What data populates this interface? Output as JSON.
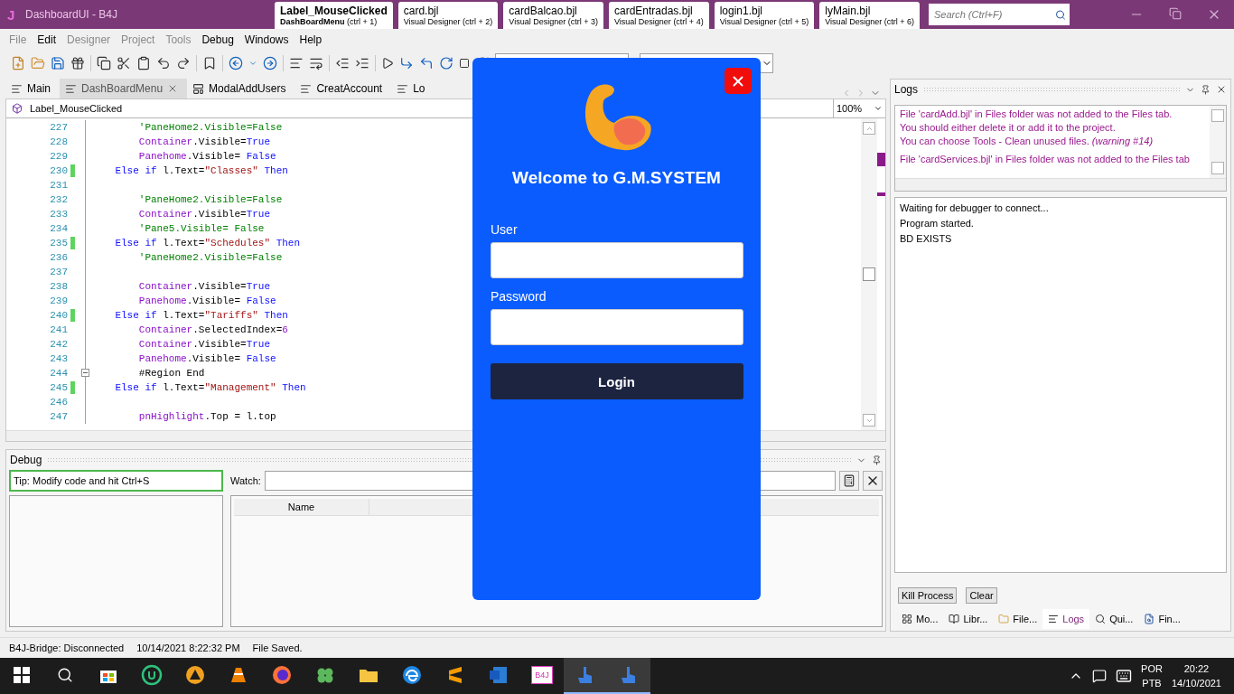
{
  "window": {
    "logo": "J",
    "title": "DashboardUI - B4J",
    "search": {
      "placeholder": "Search (Ctrl+F)"
    }
  },
  "file_tabs": [
    {
      "title": "Label_MouseClicked",
      "subtitle": "DashBoardMenu",
      "shortcut": "(ctrl + 1)",
      "selected": true
    },
    {
      "title": "card.bjl",
      "subtitle": "Visual Designer",
      "shortcut": "(ctrl + 2)",
      "selected": false
    },
    {
      "title": "cardBalcao.bjl",
      "subtitle": "Visual Designer",
      "shortcut": "(ctrl + 3)",
      "selected": false
    },
    {
      "title": "cardEntradas.bjl",
      "subtitle": "Visual Designer",
      "shortcut": "(ctrl + 4)",
      "selected": false
    },
    {
      "title": "login1.bjl",
      "subtitle": "Visual Designer",
      "shortcut": "(ctrl + 5)",
      "selected": false
    },
    {
      "title": "lyMain.bjl",
      "subtitle": "Visual Designer",
      "shortcut": "(ctrl + 6)",
      "selected": false
    }
  ],
  "menu": [
    {
      "label": "File",
      "disabled": true
    },
    {
      "label": "Edit",
      "disabled": false
    },
    {
      "label": "Designer",
      "disabled": true
    },
    {
      "label": "Project",
      "disabled": true
    },
    {
      "label": "Tools",
      "disabled": true
    },
    {
      "label": "Debug",
      "disabled": false
    },
    {
      "label": "Windows",
      "disabled": false
    },
    {
      "label": "Help",
      "disabled": false
    }
  ],
  "editor_tabs": [
    {
      "label": "Main",
      "kind": "code",
      "selected": false,
      "closable": false
    },
    {
      "label": "DashBoardMenu",
      "kind": "code",
      "selected": true,
      "closable": true
    },
    {
      "label": "ModalAddUsers",
      "kind": "layout",
      "selected": false,
      "closable": false
    },
    {
      "label": "CreatAccount",
      "kind": "code",
      "selected": false,
      "closable": false
    },
    {
      "label": "Lo",
      "kind": "code",
      "selected": false,
      "closable": false
    }
  ],
  "editor": {
    "sub": "Label_MouseClicked",
    "zoom": "100%",
    "lines": [
      {
        "number": "227",
        "changed": false,
        "fold": false,
        "tokens": [
          {
            "kind": "comment",
            "text": "        'PaneHome2.Visible=False"
          }
        ]
      },
      {
        "number": "228",
        "changed": false,
        "fold": false,
        "tokens": [
          {
            "kind": "ident",
            "text": "        Container"
          },
          {
            "kind": "plain",
            "text": ".Visible="
          },
          {
            "kind": "keyword",
            "text": "True"
          }
        ]
      },
      {
        "number": "229",
        "changed": false,
        "fold": false,
        "tokens": [
          {
            "kind": "ident",
            "text": "        Panehome"
          },
          {
            "kind": "plain",
            "text": ".Visible= "
          },
          {
            "kind": "keyword",
            "text": "False"
          }
        ]
      },
      {
        "number": "230",
        "changed": true,
        "fold": false,
        "tokens": [
          {
            "kind": "keyword",
            "text": "    Else if"
          },
          {
            "kind": "plain",
            "text": " l.Text="
          },
          {
            "kind": "string",
            "text": "\"Classes\""
          },
          {
            "kind": "keyword",
            "text": " Then"
          }
        ]
      },
      {
        "number": "231",
        "changed": false,
        "fold": false
      },
      {
        "number": "232",
        "changed": false,
        "fold": false,
        "tokens": [
          {
            "kind": "comment",
            "text": "        'PaneHome2.Visible=False"
          }
        ]
      },
      {
        "number": "233",
        "changed": false,
        "fold": false,
        "tokens": [
          {
            "kind": "ident",
            "text": "        Container"
          },
          {
            "kind": "plain",
            "text": ".Visible="
          },
          {
            "kind": "keyword",
            "text": "True"
          }
        ]
      },
      {
        "number": "234",
        "changed": false,
        "fold": false,
        "tokens": [
          {
            "kind": "comment",
            "text": "        'Pane5.Visible= False"
          }
        ]
      },
      {
        "number": "235",
        "changed": true,
        "fold": false,
        "tokens": [
          {
            "kind": "keyword",
            "text": "    Else if"
          },
          {
            "kind": "plain",
            "text": " l.Text="
          },
          {
            "kind": "string",
            "text": "\"Schedules\""
          },
          {
            "kind": "keyword",
            "text": " Then"
          }
        ]
      },
      {
        "number": "236",
        "changed": false,
        "fold": false,
        "tokens": [
          {
            "kind": "comment",
            "text": "        'PaneHome2.Visible=False"
          }
        ]
      },
      {
        "number": "237",
        "changed": false,
        "fold": false
      },
      {
        "number": "238",
        "changed": false,
        "fold": false,
        "tokens": [
          {
            "kind": "ident",
            "text": "        Container"
          },
          {
            "kind": "plain",
            "text": ".Visible="
          },
          {
            "kind": "keyword",
            "text": "True"
          }
        ]
      },
      {
        "number": "239",
        "changed": false,
        "fold": false,
        "tokens": [
          {
            "kind": "ident",
            "text": "        Panehome"
          },
          {
            "kind": "plain",
            "text": ".Visible= "
          },
          {
            "kind": "keyword",
            "text": "False"
          }
        ]
      },
      {
        "number": "240",
        "changed": true,
        "fold": false,
        "tokens": [
          {
            "kind": "keyword",
            "text": "    Else if"
          },
          {
            "kind": "plain",
            "text": " l.Text="
          },
          {
            "kind": "string",
            "text": "\"Tariffs\""
          },
          {
            "kind": "keyword",
            "text": " Then"
          }
        ]
      },
      {
        "number": "241",
        "changed": false,
        "fold": false,
        "tokens": [
          {
            "kind": "ident",
            "text": "        Container"
          },
          {
            "kind": "plain",
            "text": ".SelectedIndex="
          },
          {
            "kind": "number",
            "text": "6"
          }
        ]
      },
      {
        "number": "242",
        "changed": false,
        "fold": false,
        "tokens": [
          {
            "kind": "ident",
            "text": "        Container"
          },
          {
            "kind": "plain",
            "text": ".Visible="
          },
          {
            "kind": "keyword",
            "text": "True"
          }
        ]
      },
      {
        "number": "243",
        "changed": false,
        "fold": false,
        "tokens": [
          {
            "kind": "ident",
            "text": "        Panehome"
          },
          {
            "kind": "plain",
            "text": ".Visible= "
          },
          {
            "kind": "keyword",
            "text": "False"
          }
        ]
      },
      {
        "number": "244",
        "changed": false,
        "fold": true,
        "tokens": [
          {
            "kind": "plain",
            "text": "        #Region End"
          }
        ]
      },
      {
        "number": "245",
        "changed": true,
        "fold": false,
        "tokens": [
          {
            "kind": "keyword",
            "text": "    Else if"
          },
          {
            "kind": "plain",
            "text": " l.Text="
          },
          {
            "kind": "string",
            "text": "\"Management\""
          },
          {
            "kind": "keyword",
            "text": " Then"
          }
        ]
      },
      {
        "number": "246",
        "changed": false,
        "fold": false
      },
      {
        "number": "247",
        "changed": false,
        "fold": false,
        "tokens": [
          {
            "kind": "ident",
            "text": "        pnHighlight"
          },
          {
            "kind": "plain",
            "text": ".Top = l.top"
          }
        ]
      }
    ]
  },
  "debug": {
    "title": "Debug",
    "tip": "Tip: Modify code and hit Ctrl+S",
    "watch_label": "Watch:",
    "columns": [
      "Name"
    ]
  },
  "logs": {
    "title": "Logs",
    "warnings": [
      {
        "lines": [
          "File 'cardAdd.bjl' in Files folder was not added to the Files tab.",
          "You should either delete it or add it to the project.",
          "You can choose Tools - Clean unused files. *(warning #14)*"
        ]
      },
      {
        "lines": [
          "File 'cardServices.bjl' in Files folder was not added to the Files tab"
        ]
      }
    ],
    "output": [
      "Waiting for debugger to connect...",
      "Program started.",
      "BD EXISTS"
    ],
    "buttons": [
      "Kill Process",
      "Clear"
    ],
    "tabs": [
      {
        "label": "Mo...",
        "kind": "modules",
        "selected": false
      },
      {
        "label": "Libr...",
        "kind": "libraries",
        "selected": false
      },
      {
        "label": "File...",
        "kind": "files",
        "selected": false
      },
      {
        "label": "Logs",
        "kind": "logs",
        "selected": true
      },
      {
        "label": "Qui...",
        "kind": "quick",
        "selected": false
      },
      {
        "label": "Fin...",
        "kind": "find",
        "selected": false
      }
    ]
  },
  "status_bar": [
    "B4J-Bridge: Disconnected",
    "10/14/2021 8:22:32 PM",
    "File Saved."
  ],
  "modal": {
    "title": "Welcome to G.M.SYSTEM",
    "fields": [
      {
        "label": "User"
      },
      {
        "label": "Password"
      }
    ],
    "button": "Login"
  },
  "taskbar": {
    "apps": [
      {
        "kind": "store",
        "active": false
      },
      {
        "kind": "upwork",
        "active": false
      },
      {
        "kind": "triangle",
        "active": false
      },
      {
        "kind": "vlc",
        "active": false
      },
      {
        "kind": "firefox",
        "active": false
      },
      {
        "kind": "clover",
        "active": false
      },
      {
        "kind": "folder",
        "active": false
      },
      {
        "kind": "edge",
        "active": false
      },
      {
        "kind": "sublime",
        "active": false
      },
      {
        "kind": "word",
        "active": false
      },
      {
        "kind": "b4j",
        "label": "B4J",
        "active": false
      },
      {
        "kind": "pointer",
        "active": true
      },
      {
        "kind": "pointer",
        "active": true
      }
    ],
    "language": [
      "POR",
      "PTB"
    ],
    "time": "20:22",
    "date": "14/10/2021"
  }
}
